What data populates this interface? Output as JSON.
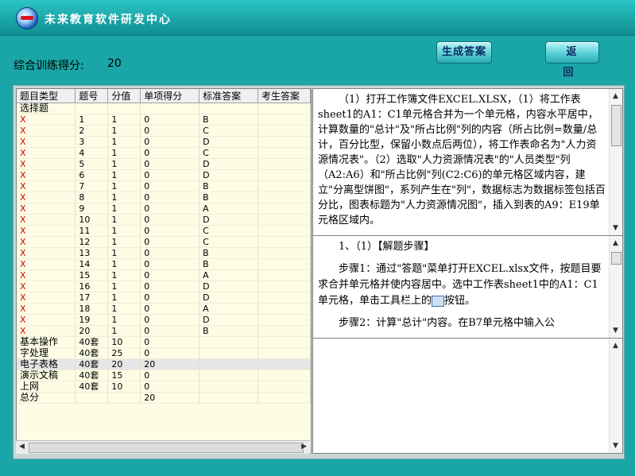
{
  "app": {
    "title": "未来教育软件研发中心"
  },
  "score": {
    "label": "综合训练得分:",
    "value": "20"
  },
  "buttons": {
    "generate": "生成答案",
    "back": "返 回"
  },
  "table": {
    "headers": [
      "题目类型",
      "题号",
      "分值",
      "单项得分",
      "标准答案",
      "考生答案"
    ],
    "rows": [
      [
        "选择题",
        "",
        "",
        "",
        "",
        ""
      ],
      [
        "X",
        "1",
        "1",
        "0",
        "B",
        ""
      ],
      [
        "X",
        "2",
        "1",
        "0",
        "C",
        ""
      ],
      [
        "X",
        "3",
        "1",
        "0",
        "D",
        ""
      ],
      [
        "X",
        "4",
        "1",
        "0",
        "C",
        ""
      ],
      [
        "X",
        "5",
        "1",
        "0",
        "D",
        ""
      ],
      [
        "X",
        "6",
        "1",
        "0",
        "D",
        ""
      ],
      [
        "X",
        "7",
        "1",
        "0",
        "B",
        ""
      ],
      [
        "X",
        "8",
        "1",
        "0",
        "B",
        ""
      ],
      [
        "X",
        "9",
        "1",
        "0",
        "A",
        ""
      ],
      [
        "X",
        "10",
        "1",
        "0",
        "D",
        ""
      ],
      [
        "X",
        "11",
        "1",
        "0",
        "C",
        ""
      ],
      [
        "X",
        "12",
        "1",
        "0",
        "C",
        ""
      ],
      [
        "X",
        "13",
        "1",
        "0",
        "B",
        ""
      ],
      [
        "X",
        "14",
        "1",
        "0",
        "B",
        ""
      ],
      [
        "X",
        "15",
        "1",
        "0",
        "A",
        ""
      ],
      [
        "X",
        "16",
        "1",
        "0",
        "D",
        ""
      ],
      [
        "X",
        "17",
        "1",
        "0",
        "D",
        ""
      ],
      [
        "X",
        "18",
        "1",
        "0",
        "A",
        ""
      ],
      [
        "X",
        "19",
        "1",
        "0",
        "D",
        ""
      ],
      [
        "X",
        "20",
        "1",
        "0",
        "B",
        ""
      ],
      [
        "基本操作",
        "40套",
        "10",
        "0",
        "",
        ""
      ],
      [
        "字处理",
        "40套",
        "25",
        "0",
        "",
        ""
      ],
      [
        "电子表格",
        "40套",
        "20",
        "20",
        "",
        ""
      ],
      [
        "演示文稿",
        "40套",
        "15",
        "0",
        "",
        ""
      ],
      [
        "上网",
        "40套",
        "10",
        "0",
        "",
        ""
      ],
      [
        "总分",
        "",
        "",
        "20",
        "",
        ""
      ]
    ],
    "selected_row": 23
  },
  "question": {
    "text": "（1）打开工作簿文件EXCEL.XLSX，（1）将工作表sheet1的A1：C1单元格合并为一个单元格，内容水平居中，计算数量的\"总计\"及\"所占比例\"列的内容（所占比例=数量/总计，百分比型，保留小数点后两位），将工作表命名为\"人力资源情况表\"。（2）选取\"人力资源情况表\"的\"人员类型\"列（A2:A6）和\"所占比例\"列(C2:C6)的单元格区域内容，建立\"分离型饼图\"，系列产生在\"列\"，数据标志为数据标签包括百分比，图表标题为\"人力资源情况图\"，插入到表的A9：E19单元格区域内。"
  },
  "solution": {
    "heading": "1、（1）【解题步骤】",
    "step1_before": "步骤1：通过\"答题\"菜单打开EXCEL.xlsx文件，按题目要求合并单元格并使内容居中。选中工作表sheet1中的A1：C1单元格，单击工具栏上的",
    "step1_after": "按钮。",
    "step2": "步骤2：计算\"总计\"内容。在B7单元格中输入公"
  }
}
